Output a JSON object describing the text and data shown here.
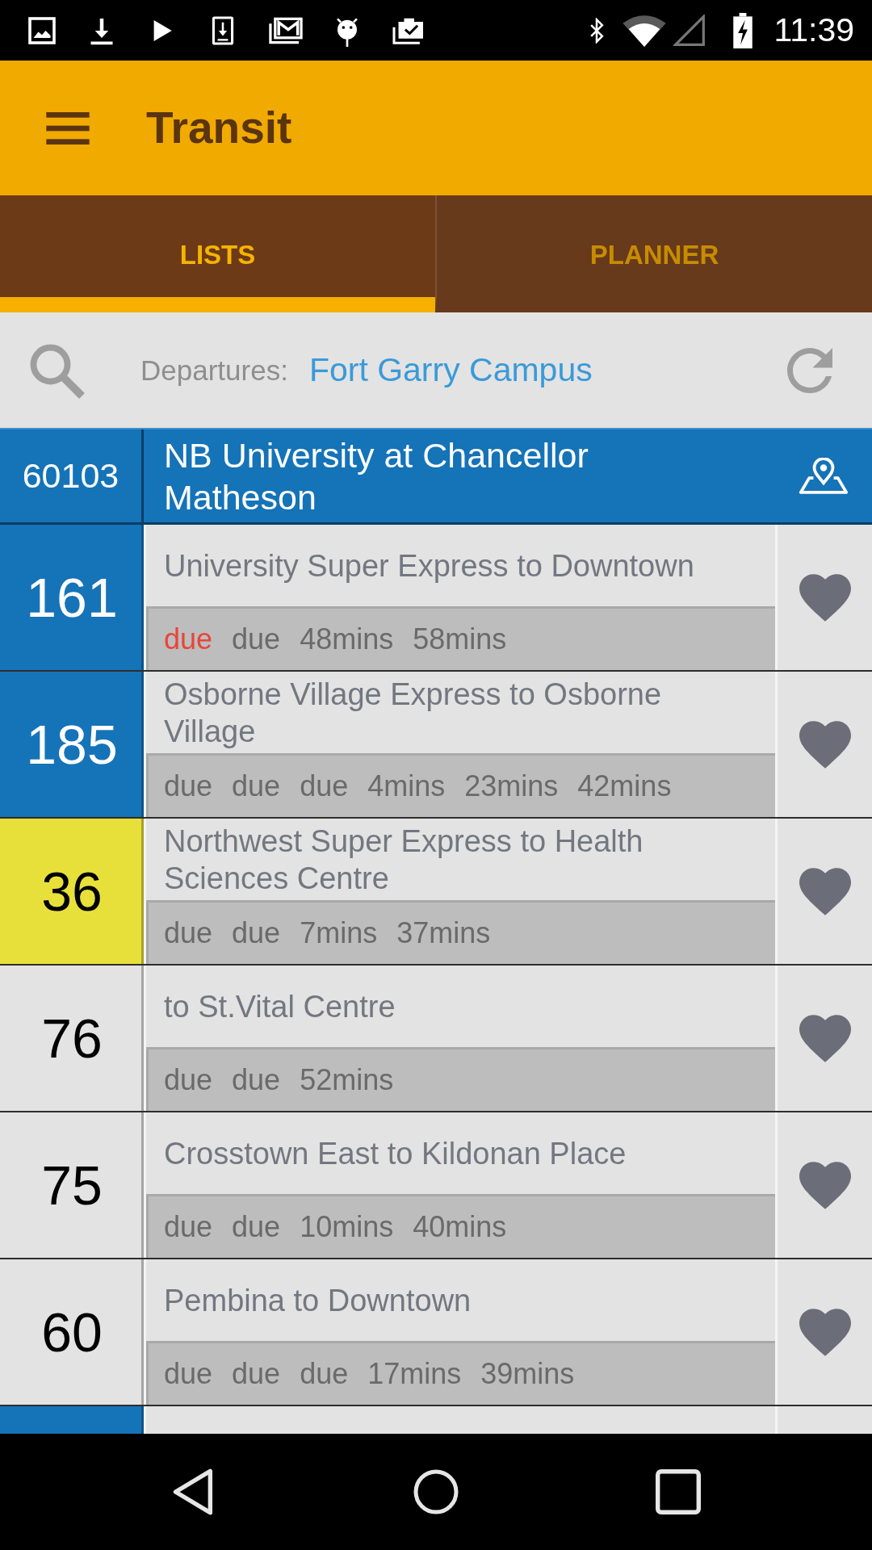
{
  "status_bar": {
    "time": "11:39"
  },
  "app_bar": {
    "title": "Transit"
  },
  "tabs": [
    {
      "label": "LISTS",
      "selected": true
    },
    {
      "label": "PLANNER",
      "selected": false
    }
  ],
  "search": {
    "label": "Departures:",
    "value": "Fort Garry Campus"
  },
  "stop": {
    "number": "60103",
    "name": "NB University at Chancellor Matheson"
  },
  "routes": [
    {
      "number": "161",
      "color": "#1573b8",
      "destination": "University Super Express to Downtown",
      "departures": [
        {
          "time": "due",
          "highlighted": true
        },
        {
          "time": "due",
          "highlighted": false
        },
        {
          "time": "48mins",
          "highlighted": false
        },
        {
          "time": "58mins",
          "highlighted": false
        }
      ]
    },
    {
      "number": "185",
      "color": "#1573b8",
      "destination": "Osborne Village Express to Osborne Village",
      "departures": [
        {
          "time": "due",
          "highlighted": false
        },
        {
          "time": "due",
          "highlighted": false
        },
        {
          "time": "due",
          "highlighted": false
        },
        {
          "time": "4mins",
          "highlighted": false
        },
        {
          "time": "23mins",
          "highlighted": false
        },
        {
          "time": "42mins",
          "highlighted": false
        }
      ]
    },
    {
      "number": "36",
      "color": "#e8e03a",
      "destination": "Northwest Super Express to Health Sciences Centre",
      "departures": [
        {
          "time": "due",
          "highlighted": false
        },
        {
          "time": "due",
          "highlighted": false
        },
        {
          "time": "7mins",
          "highlighted": false
        },
        {
          "time": "37mins",
          "highlighted": false
        }
      ]
    },
    {
      "number": "76",
      "color": "#e3e3e3",
      "destination": "to St.Vital Centre",
      "departures": [
        {
          "time": "due",
          "highlighted": false
        },
        {
          "time": "due",
          "highlighted": false
        },
        {
          "time": "52mins",
          "highlighted": false
        }
      ]
    },
    {
      "number": "75",
      "color": "#e3e3e3",
      "destination": "Crosstown East to Kildonan Place",
      "departures": [
        {
          "time": "due",
          "highlighted": false
        },
        {
          "time": "due",
          "highlighted": false
        },
        {
          "time": "10mins",
          "highlighted": false
        },
        {
          "time": "40mins",
          "highlighted": false
        }
      ]
    },
    {
      "number": "60",
      "color": "#e3e3e3",
      "destination": "Pembina to Downtown",
      "departures": [
        {
          "time": "due",
          "highlighted": false
        },
        {
          "time": "due",
          "highlighted": false
        },
        {
          "time": "due",
          "highlighted": false
        },
        {
          "time": "17mins",
          "highlighted": false
        },
        {
          "time": "39mins",
          "highlighted": false
        }
      ]
    },
    {
      "color": "#1573b8"
    }
  ]
}
